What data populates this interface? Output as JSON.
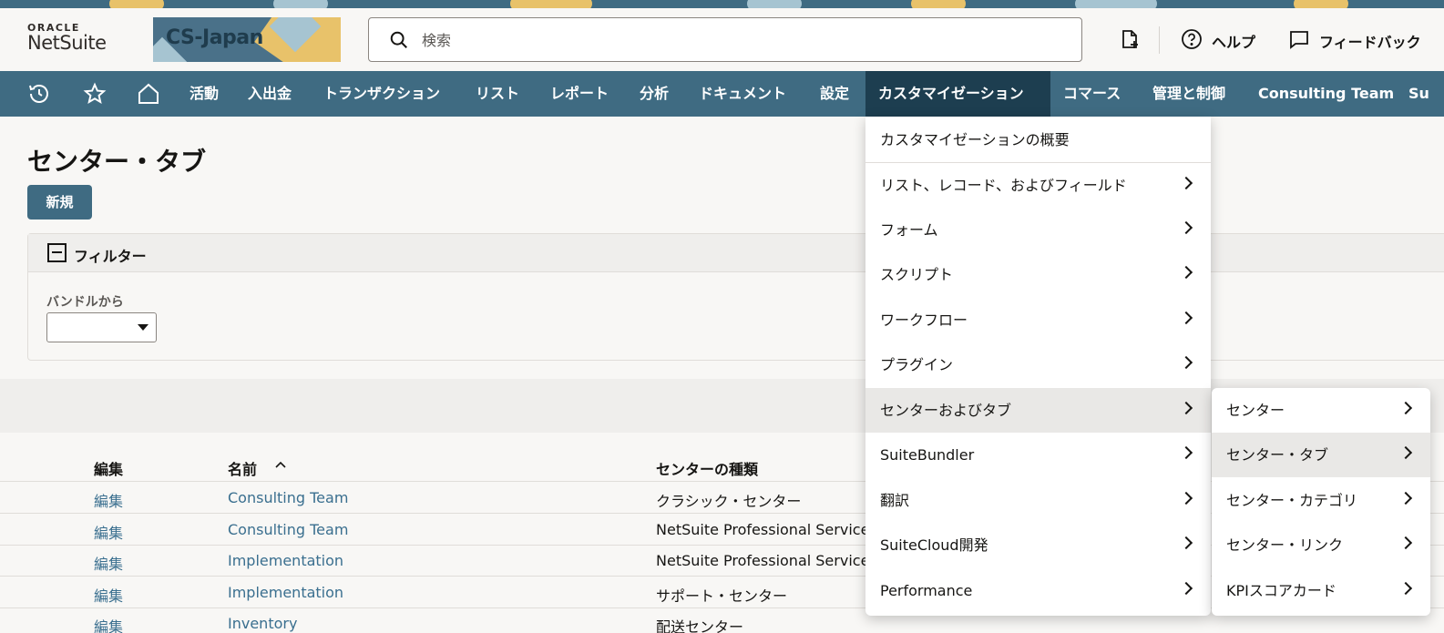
{
  "header": {
    "logo_top": "ORACLE",
    "logo_bottom": "NetSuite",
    "banner_text": "CS-Japan",
    "search_placeholder": "検索",
    "help_label": "ヘルプ",
    "feedback_label": "フィードバック"
  },
  "nav": {
    "items": [
      {
        "label": "活動"
      },
      {
        "label": "入出金"
      },
      {
        "label": "トランザクション"
      },
      {
        "label": "リスト"
      },
      {
        "label": "レポート"
      },
      {
        "label": "分析"
      },
      {
        "label": "ドキュメント"
      },
      {
        "label": "設定"
      },
      {
        "label": "カスタマイゼーション"
      },
      {
        "label": "コマース"
      },
      {
        "label": "管理と制御"
      },
      {
        "label": "Consulting Team"
      },
      {
        "label": "Su"
      }
    ]
  },
  "page": {
    "title": "センター・タブ",
    "new_button": "新規",
    "filter_label": "フィルター",
    "bundle_label": "バンドルから"
  },
  "table": {
    "headers": {
      "edit": "編集",
      "name": "名前",
      "center_type": "センターの種類"
    },
    "rows": [
      {
        "edit": "編集",
        "name": "Consulting Team",
        "center_type": "クラシック・センター"
      },
      {
        "edit": "編集",
        "name": "Consulting Team",
        "center_type": "NetSuite Professional Services"
      },
      {
        "edit": "編集",
        "name": "Implementation",
        "center_type": "NetSuite Professional Services"
      },
      {
        "edit": "編集",
        "name": "Implementation",
        "center_type": "サポート・センター"
      },
      {
        "edit": "編集",
        "name": "Inventory",
        "center_type": "配送センター"
      }
    ]
  },
  "menu": {
    "items": [
      {
        "label": "カスタマイゼーションの概要"
      },
      {
        "label": "リスト、レコード、およびフィールド"
      },
      {
        "label": "フォーム"
      },
      {
        "label": "スクリプト"
      },
      {
        "label": "ワークフロー"
      },
      {
        "label": "プラグイン"
      },
      {
        "label": "センターおよびタブ"
      },
      {
        "label": "SuiteBundler"
      },
      {
        "label": "翻訳"
      },
      {
        "label": "SuiteCloud開発"
      },
      {
        "label": "Performance"
      }
    ]
  },
  "submenu": {
    "items": [
      {
        "label": "センター"
      },
      {
        "label": "センター・タブ"
      },
      {
        "label": "センター・カテゴリ"
      },
      {
        "label": "センター・リンク"
      },
      {
        "label": "KPIスコアカード"
      }
    ]
  },
  "colors": {
    "nav_bg": "#3f6b82",
    "nav_active": "#1d3e50",
    "link": "#3a6f8f",
    "page_bg": "#f8f7f5"
  }
}
